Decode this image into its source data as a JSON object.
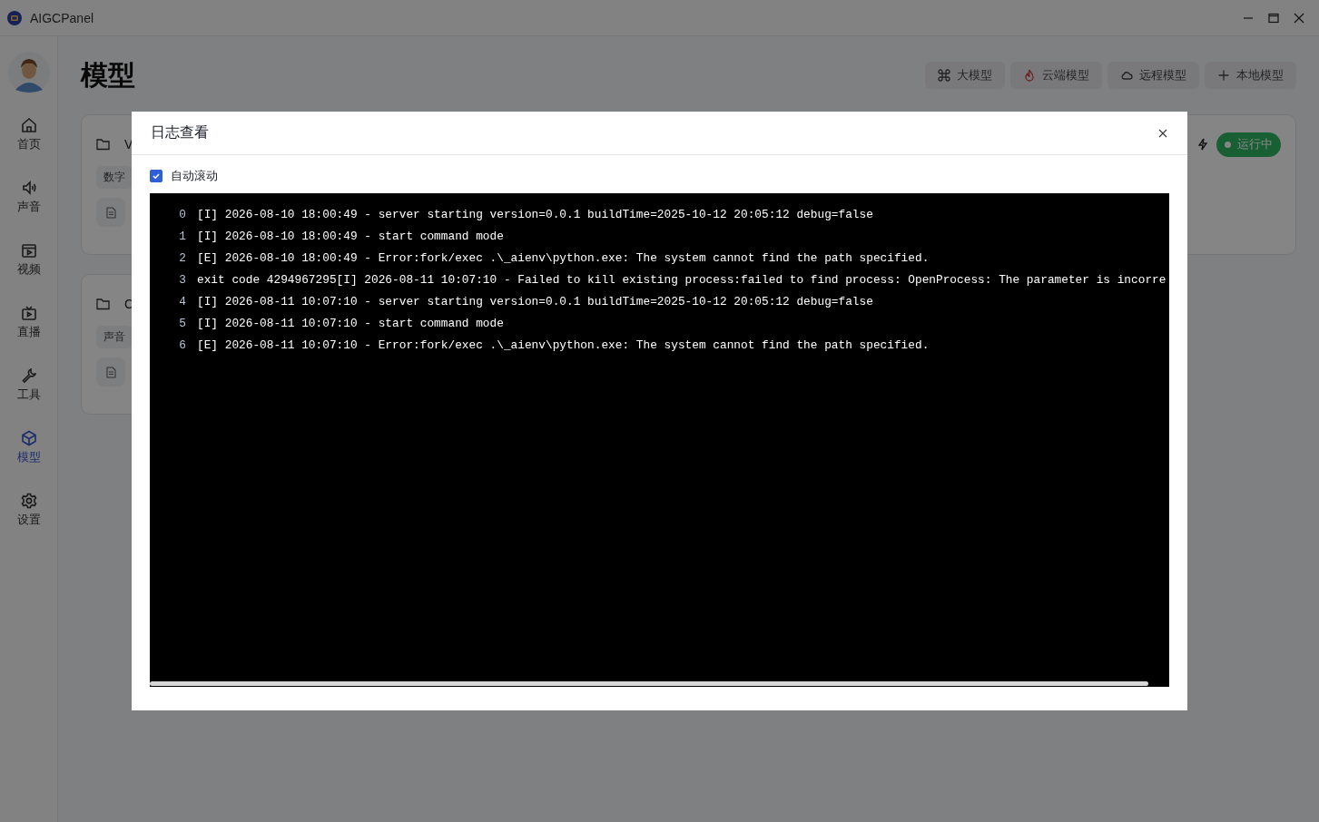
{
  "app": {
    "title": "AIGCPanel"
  },
  "sidebar": {
    "items": [
      {
        "label": "首页",
        "kind": "home",
        "selected": false
      },
      {
        "label": "声音",
        "kind": "sound",
        "selected": false
      },
      {
        "label": "视频",
        "kind": "video",
        "selected": false
      },
      {
        "label": "直播",
        "kind": "live",
        "selected": false
      },
      {
        "label": "工具",
        "kind": "tool",
        "selected": false
      },
      {
        "label": "模型",
        "kind": "model",
        "selected": true
      },
      {
        "label": "设置",
        "kind": "settings",
        "selected": false
      }
    ]
  },
  "page": {
    "title": "模型",
    "buttons": [
      {
        "label": "大模型",
        "kind": "command"
      },
      {
        "label": "云端模型",
        "kind": "fire"
      },
      {
        "label": "远程模型",
        "kind": "cloud"
      },
      {
        "label": "本地模型",
        "kind": "plus"
      }
    ],
    "cards": [
      {
        "name": "V",
        "tag": "数字",
        "status": "运行中"
      },
      {
        "name": "C",
        "tag": "声音"
      }
    ]
  },
  "dialog": {
    "title": "日志查看",
    "auto_scroll": {
      "label": "自动滚动",
      "checked": true
    },
    "log_lines": [
      {
        "number": "0",
        "text": "[I] 2026-08-10 18:00:49 - server starting version=0.0.1 buildTime=2025-10-12 20:05:12 debug=false"
      },
      {
        "number": "1",
        "text": "[I] 2026-08-10 18:00:49 - start command mode"
      },
      {
        "number": "2",
        "text": "[E] 2026-08-10 18:00:49 - Error:fork/exec .\\_aienv\\python.exe: The system cannot find the path specified."
      },
      {
        "number": "3",
        "text": "exit code 4294967295[I] 2026-08-11 10:07:10 - Failed to kill existing process:failed to find process: OpenProcess: The parameter is incorre"
      },
      {
        "number": "4",
        "text": "[I] 2026-08-11 10:07:10 - server starting version=0.0.1 buildTime=2025-10-12 20:05:12 debug=false"
      },
      {
        "number": "5",
        "text": "[I] 2026-08-11 10:07:10 - start command mode"
      },
      {
        "number": "6",
        "text": "[E] 2026-08-11 10:07:10 - Error:fork/exec .\\_aienv\\python.exe: The system cannot find the path specified."
      }
    ]
  }
}
